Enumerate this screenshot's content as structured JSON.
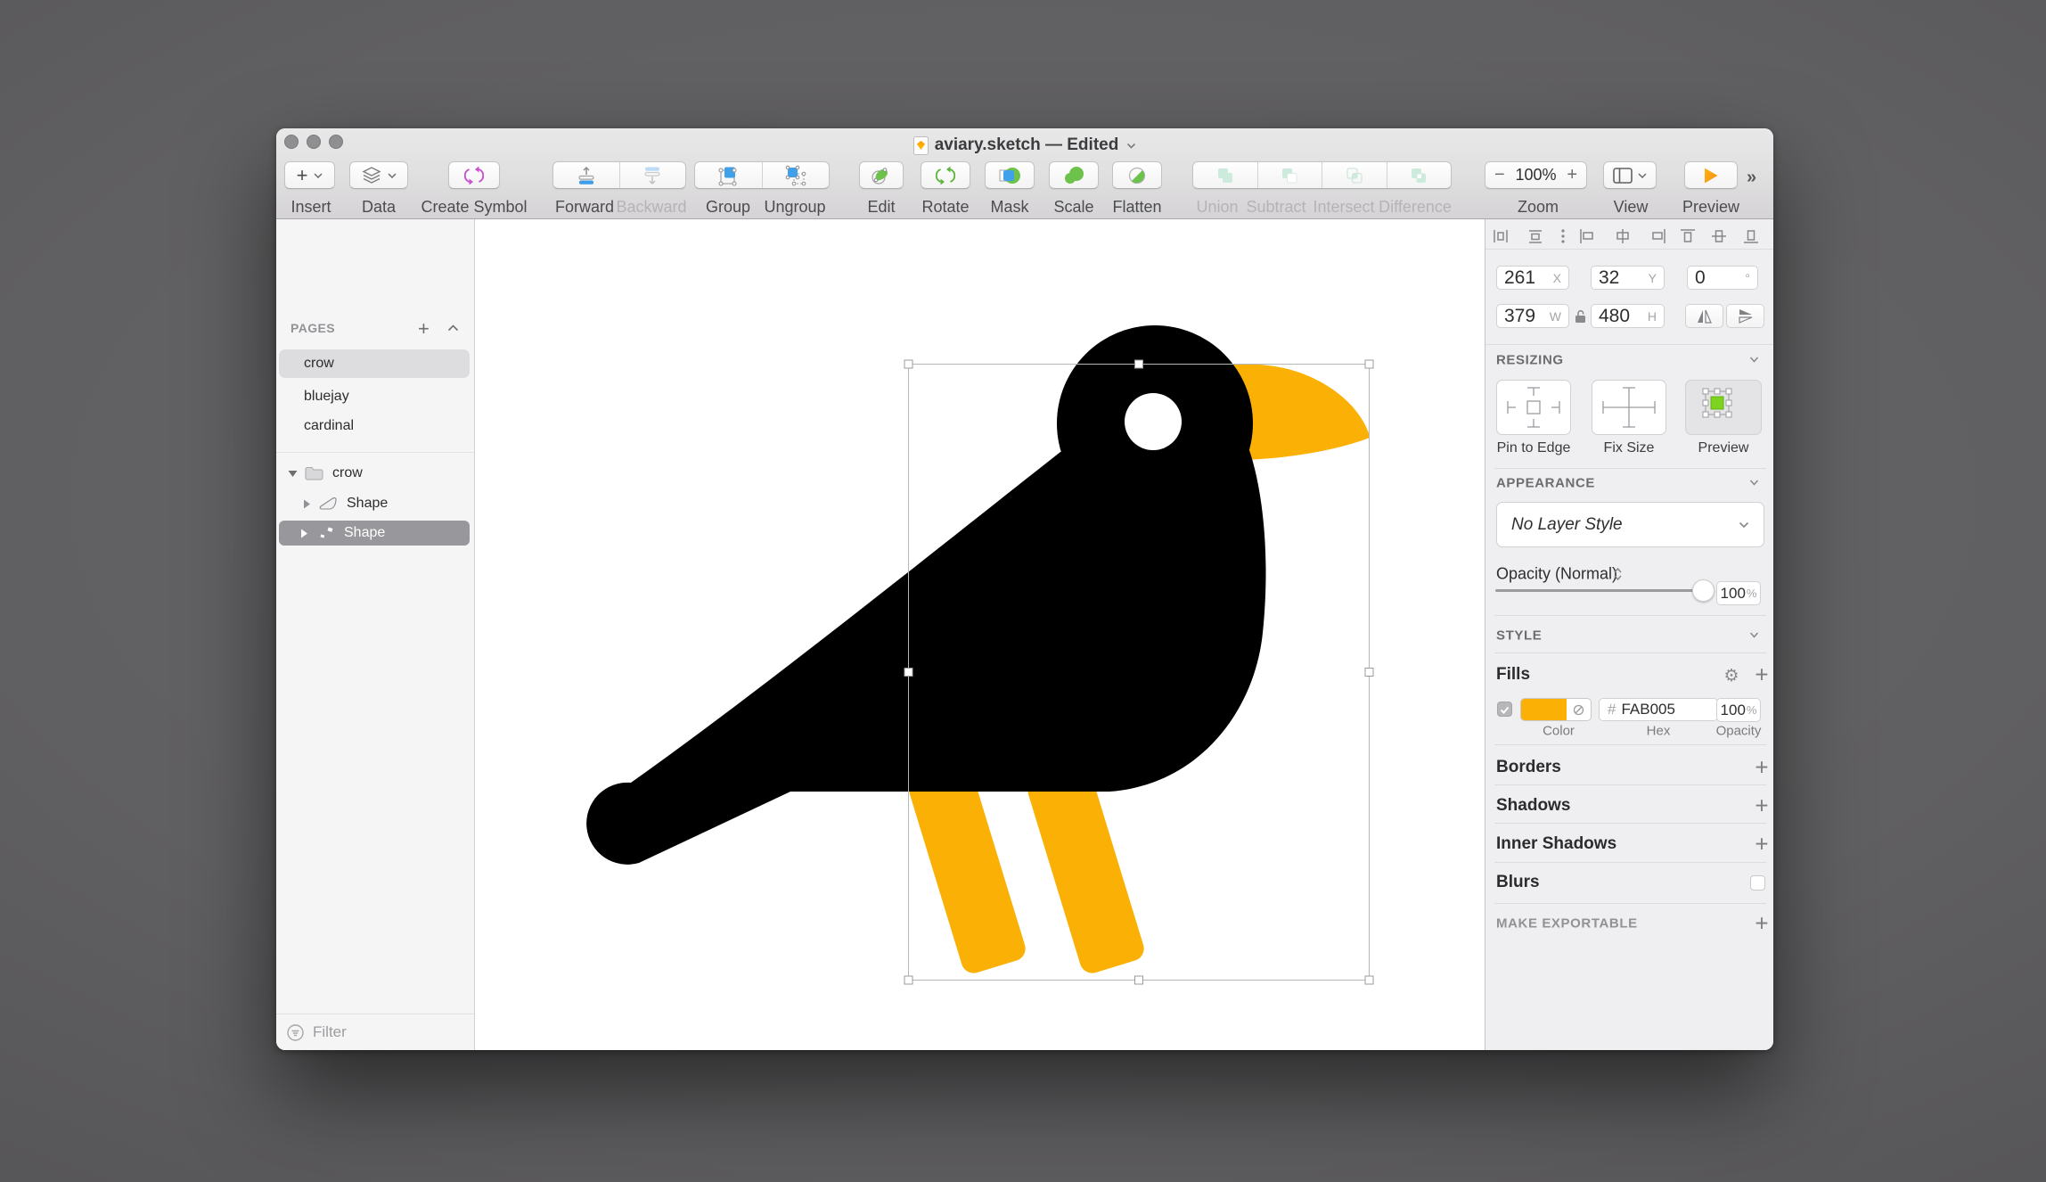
{
  "window": {
    "title": "aviary.sketch — Edited"
  },
  "toolbar": {
    "insert_plus": "+",
    "buttons": [
      {
        "label": "Insert"
      },
      {
        "label": "Data"
      },
      {
        "label": "Create Symbol"
      },
      {
        "label": "Forward"
      },
      {
        "label": "Backward"
      },
      {
        "label": "Group"
      },
      {
        "label": "Ungroup"
      },
      {
        "label": "Edit"
      },
      {
        "label": "Rotate"
      },
      {
        "label": "Mask"
      },
      {
        "label": "Scale"
      },
      {
        "label": "Flatten"
      },
      {
        "label": "Union"
      },
      {
        "label": "Subtract"
      },
      {
        "label": "Intersect"
      },
      {
        "label": "Difference"
      },
      {
        "label": "Zoom"
      },
      {
        "label": "View"
      },
      {
        "label": "Preview"
      }
    ],
    "zoom_minus": "−",
    "zoom_value": "100%",
    "zoom_plus": "+"
  },
  "sidebar": {
    "pages_header": "PAGES",
    "pages": [
      {
        "name": "crow"
      },
      {
        "name": "bluejay"
      },
      {
        "name": "cardinal"
      }
    ],
    "layers": [
      {
        "name": "crow"
      },
      {
        "name": "Shape"
      },
      {
        "name": "Shape"
      }
    ],
    "filter_placeholder": "Filter"
  },
  "canvas": {
    "bird": {
      "body_color": "#000000",
      "accent_color": "#FAB005",
      "eye_color": "#FFFFFF"
    }
  },
  "inspector": {
    "position": {
      "x": "261",
      "x_unit": "X",
      "y": "32",
      "y_unit": "Y",
      "rotation": "0",
      "rotation_unit": "°"
    },
    "size": {
      "w": "379",
      "w_unit": "W",
      "h": "480",
      "h_unit": "H"
    },
    "resizing": {
      "header": "RESIZING",
      "options": [
        "Pin to Edge",
        "Fix Size",
        "Preview"
      ]
    },
    "appearance": {
      "header": "APPEARANCE",
      "layer_style": "No Layer Style",
      "opacity_label": "Opacity (Normal)",
      "opacity_value": "100",
      "percent": "%"
    },
    "style": {
      "header": "STYLE",
      "fills_label": "Fills",
      "fill": {
        "hex_prefix": "#",
        "hex": "FAB005",
        "opacity": "100",
        "color": "#FAB005"
      },
      "col_labels": [
        "Color",
        "Hex",
        "Opacity"
      ],
      "rows": [
        "Borders",
        "Shadows",
        "Inner Shadows",
        "Blurs"
      ],
      "make_exportable": "MAKE EXPORTABLE"
    }
  }
}
